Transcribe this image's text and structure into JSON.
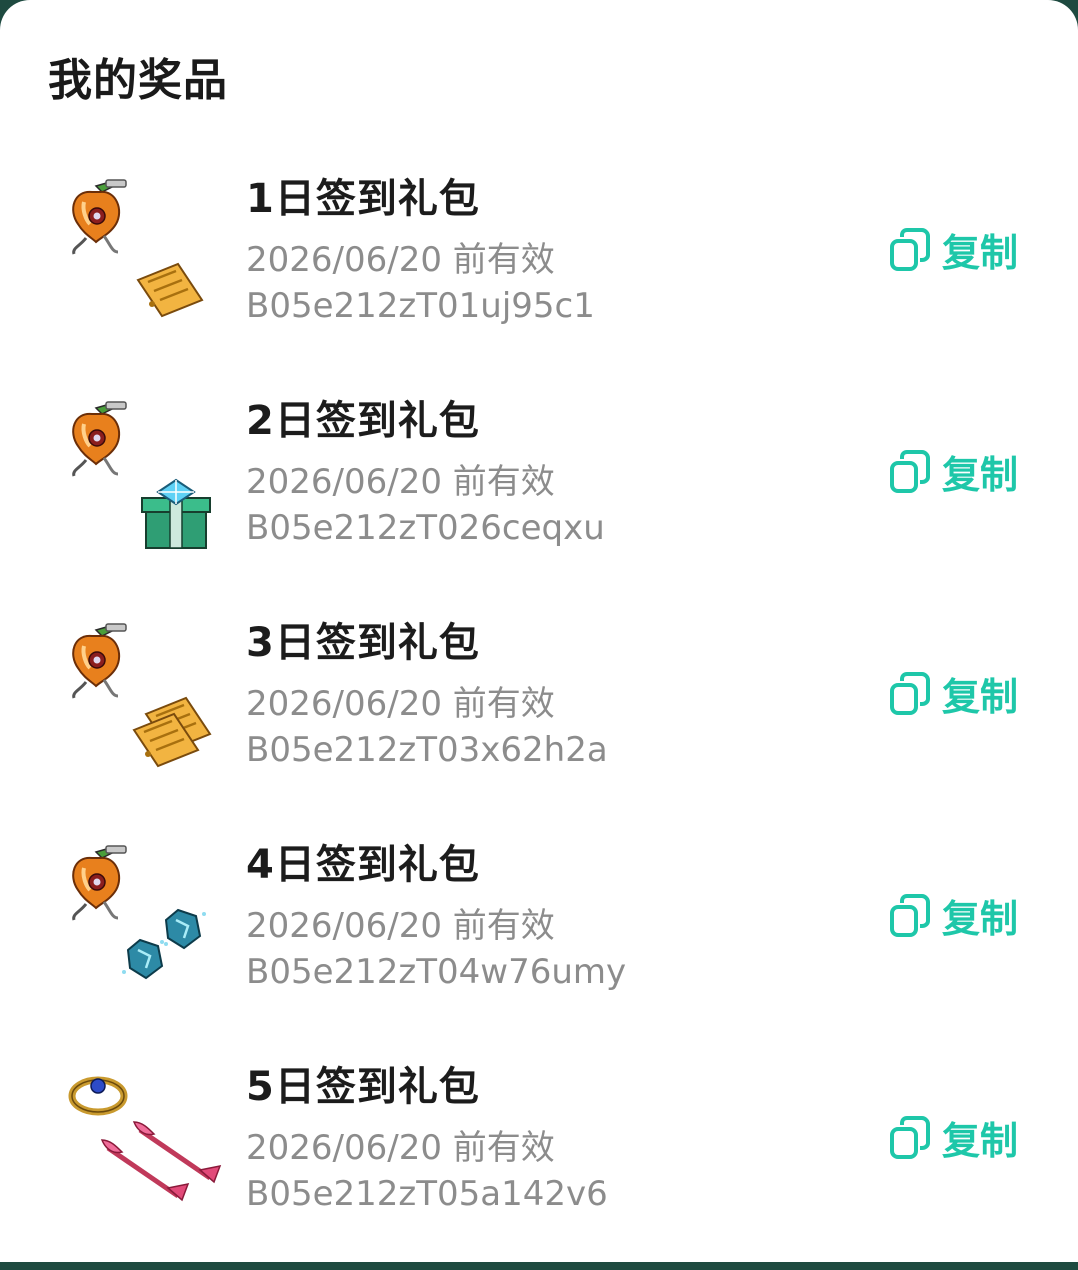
{
  "page": {
    "title": "我的奖品"
  },
  "colors": {
    "accent": "#1ec7a9",
    "title_text": "#1c1c1c",
    "meta_text": "#8c8c8c",
    "backdrop": "#1e4a40"
  },
  "prizes": [
    {
      "name": "1日签到礼包",
      "expiry": "2026/06/20 前有效",
      "code": "B05e212zT01uj95c1",
      "copy_label": "复制",
      "icons": [
        "apple-charm-icon",
        "golden-ticket-icon"
      ]
    },
    {
      "name": "2日签到礼包",
      "expiry": "2026/06/20 前有效",
      "code": "B05e212zT026ceqxu",
      "copy_label": "复制",
      "icons": [
        "apple-charm-icon",
        "diamond-gift-box-icon"
      ]
    },
    {
      "name": "3日签到礼包",
      "expiry": "2026/06/20 前有效",
      "code": "B05e212zT03x62h2a",
      "copy_label": "复制",
      "icons": [
        "apple-charm-icon",
        "golden-tickets-icon"
      ]
    },
    {
      "name": "4日签到礼包",
      "expiry": "2026/06/20 前有效",
      "code": "B05e212zT04w76umy",
      "copy_label": "复制",
      "icons": [
        "apple-charm-icon",
        "blue-crystals-icon"
      ]
    },
    {
      "name": "5日签到礼包",
      "expiry": "2026/06/20 前有效",
      "code": "B05e212zT05a142v6",
      "copy_label": "复制",
      "icons": [
        "gold-ring-icon",
        "cupid-arrows-icon"
      ]
    }
  ]
}
